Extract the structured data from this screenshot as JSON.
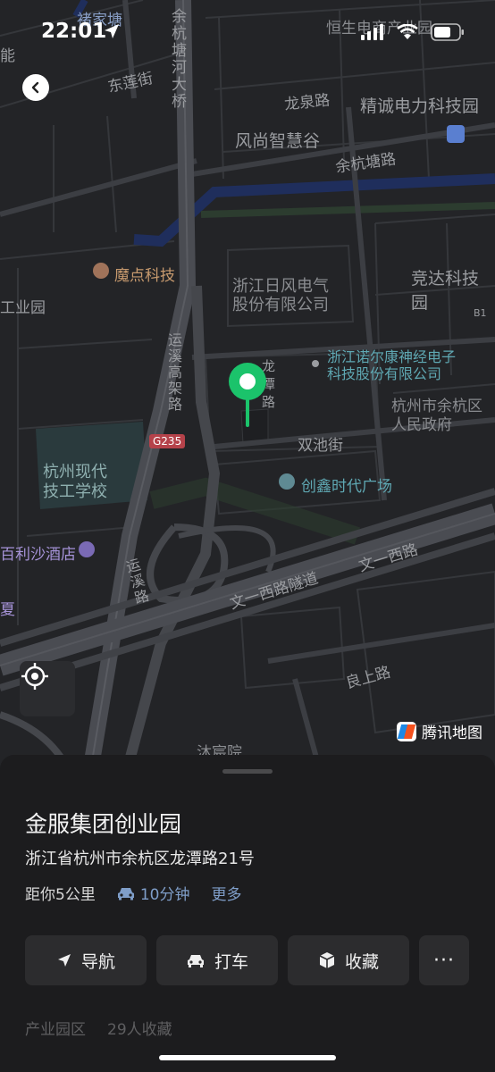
{
  "status_bar": {
    "time": "22:01"
  },
  "map": {
    "labels": {
      "chujiatang": "褚家塘",
      "hengsheng": "恒生电商产业园",
      "yuhang_bridge": "余杭塘河大桥",
      "neng": "能",
      "lianjie": "东莲街",
      "longquan": "龙泉路",
      "jingcheng": "精诚电力科技园",
      "fengshang": "风尚智慧谷",
      "yuhangtang": "余杭塘路",
      "modian": "魔点科技",
      "jingda": "竞达科技园",
      "rifeng": "浙江日风电气\n股份有限公司",
      "gongyeyuan": "工业园",
      "b1": "B1",
      "nuoerkang": "浙江诺尔康神经电子\n科技股份有限公司",
      "yunxi_elevated": "运溪高架路",
      "longtan_road": "龙潭路",
      "government": "杭州市余杭区\n人民政府",
      "g235": "G235",
      "shuangchi": "双池街",
      "xiandai": "杭州现代\n技工学校",
      "chuangxin": "创鑫时代广场",
      "baili": "百利沙酒店",
      "wenyi_west": "文一西路",
      "yunxi_road": "运溪路",
      "wenyi_tunnel": "文一西路隧道",
      "xia": "夏",
      "liangshang": "良上路",
      "muchen": "沐宸院"
    },
    "brand": "腾讯地图"
  },
  "sheet": {
    "title": "金服集团创业园",
    "address": "浙江省杭州市余杭区龙潭路21号",
    "distance": "距你5公里",
    "drive_time": "10分钟",
    "more": "更多",
    "actions": {
      "navigate": "导航",
      "taxi": "打车",
      "favorite": "收藏",
      "more_dots": "···"
    },
    "category": "产业园区",
    "favorites_count": "29人收藏"
  }
}
